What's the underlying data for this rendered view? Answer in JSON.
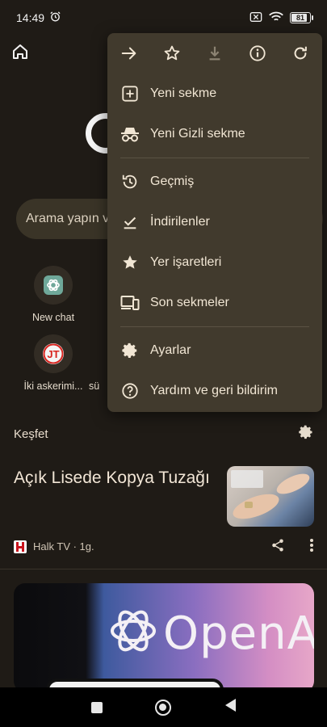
{
  "status": {
    "time": "14:49",
    "battery": "81",
    "battery_level": 0.81
  },
  "search": {
    "placeholder": "Arama yapın v"
  },
  "shortcuts": [
    {
      "label": "New chat",
      "icon": "chatgpt-icon"
    },
    {
      "label": "İki askerimi...",
      "icon": "jt-logo-icon",
      "logo_text": "JT"
    },
    {
      "label": "sü",
      "icon": ""
    }
  ],
  "feed": {
    "section_title": "Keşfet",
    "article": {
      "title": "Açık Lisede Kopya Tuzağı",
      "source": "Halk TV · 1g."
    },
    "big_image_text": "OpenA"
  },
  "menu": {
    "items": [
      {
        "label": "Yeni sekme",
        "icon": "new-tab-icon"
      },
      {
        "label": "Yeni Gizli sekme",
        "icon": "incognito-icon"
      },
      {
        "label": "Geçmiş",
        "icon": "history-icon"
      },
      {
        "label": "İndirilenler",
        "icon": "downloads-icon"
      },
      {
        "label": "Yer işaretleri",
        "icon": "star-icon"
      },
      {
        "label": "Son sekmeler",
        "icon": "devices-icon"
      },
      {
        "label": "Ayarlar",
        "icon": "gear-icon"
      },
      {
        "label": "Yardım ve geri bildirim",
        "icon": "help-icon"
      }
    ]
  },
  "colors": {
    "background": "#1f1b16",
    "menu": "#413a2d",
    "text": "#f1e6d4"
  }
}
